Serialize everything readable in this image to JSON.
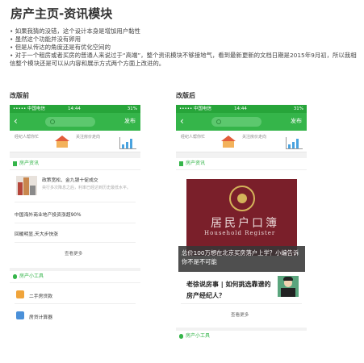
{
  "page_title": "房产主页-资讯模块",
  "bullets": [
    "• 如果我猜的没错，这个设计本身是增加用户黏性",
    "• 虽然这个功能并没有卵用",
    "• 但是从传达的角度还是有优化空间的",
    "• 对于一个租房或者买房的普通人来说过于“高端”，整个资讯模块不够接地气，看到最新更新的文档日期是2015年9月初，所以我相信整个模块还是可以从内容和展示方式两个方面上改进的。"
  ],
  "before": {
    "label": "改版前",
    "status_left": "••••• 中国电信",
    "status_time": "14:44",
    "status_right": "31%",
    "publish": "发布",
    "card1": "经纪人帮你忙",
    "card2": "关注房价走向",
    "news_header": "房产资讯",
    "item1_title": "政策宽松、金九银十促成交",
    "item1_sub": "央行多次降息之后，利率已经达到历史最低水平。",
    "item2_title": "中国海外商业地产投资涨超90%",
    "item3_title": "回暖明显,天大步快涨",
    "more": "查看更多",
    "tools_header": "房产小工具",
    "tool1": "二手房贷款",
    "tool2": "房贷计算器"
  },
  "after": {
    "label": "改版后",
    "status_left": "••••• 中国电信",
    "status_time": "14:44",
    "status_right": "31%",
    "publish": "发布",
    "card1": "经纪人帮你忙",
    "card2": "关注房价走向",
    "news_header": "房产资讯",
    "passport_cn": "居民户口簿",
    "passport_en": "Household  Register",
    "overlay_text": "总价100万想在北京买房落户上学？小编告诉你不是不可能",
    "news_title": "老徐说房事 | 如何挑选靠谱的房产经纪人？",
    "more": "查看更多",
    "tools_header": "房产小工具"
  }
}
